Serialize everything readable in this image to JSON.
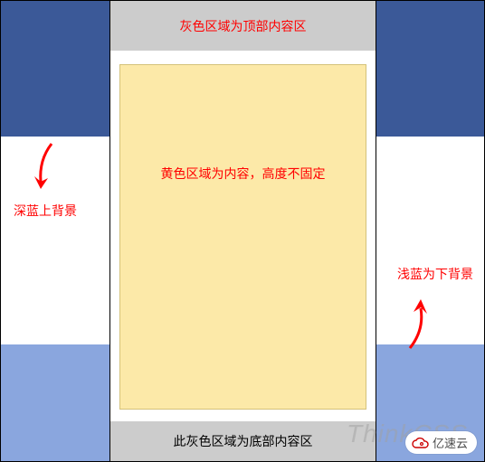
{
  "colors": {
    "bg_upper": "#3b5998",
    "bg_lower": "#8aa6de",
    "gray_area": "#cccccc",
    "yellow_area": "#fce9a8",
    "annotation_text": "#ff0000"
  },
  "top_area_label": "灰色区域为顶部内容区",
  "yellow_area_label": "黄色区域为内容，高度不固定",
  "bottom_area_label": "此灰色区域为底部内容区",
  "annotation_left": "深蓝上背景",
  "annotation_right": "浅蓝为下背景",
  "watermark_text": "ThinkCSS",
  "brand_label": "亿速云"
}
